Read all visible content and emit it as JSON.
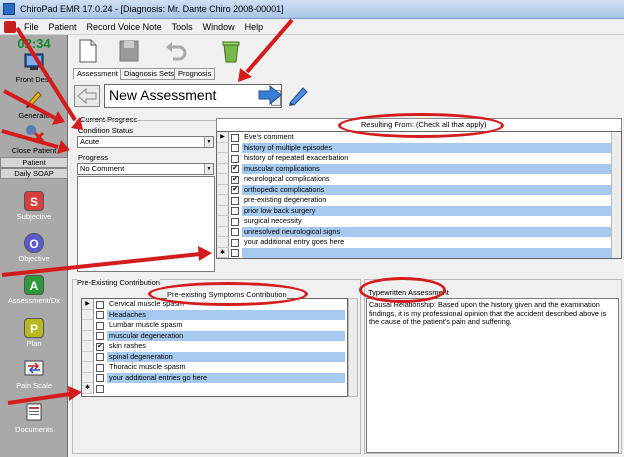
{
  "window": {
    "title": "ChiroPad EMR  17.0.24 - [Diagnosis: Mr. Dante Chiro 2008-00001]"
  },
  "menu": [
    "File",
    "Patient",
    "Record Voice Note",
    "Tools",
    "Window",
    "Help"
  ],
  "sidebar": {
    "clock": "02:34",
    "items": {
      "front_desk": "Front Desk",
      "generate": "Generate",
      "close_patient": "Close Patient",
      "patient": "Patient",
      "daily_soap": "Daily SOAP",
      "subjective": "Subjective",
      "objective": "Objective",
      "assessment": "Assessment/Dx",
      "plan": "Plan",
      "pain_scale": "Pain Scale",
      "documents": "Documents"
    },
    "letters": {
      "s": "S",
      "o": "O",
      "a": "A",
      "p": "P"
    }
  },
  "tabs": [
    "Assessment",
    "Diagnosis Sets",
    "Prognosis"
  ],
  "assessment_select": "New Assessment",
  "current_progress": {
    "group_label": "Current Progress",
    "condition_label": "Condition Status",
    "condition_value": "Acute",
    "progress_label": "Progress",
    "progress_value": "No Comment"
  },
  "resulting_from": {
    "header": "Resulting From:  (Check all that apply)",
    "rows": [
      {
        "text": "Eve's comment",
        "checked": false,
        "hl": false,
        "current": true
      },
      {
        "text": "history of multiple episodes",
        "checked": false,
        "hl": true
      },
      {
        "text": "history of repeated exacerbation",
        "checked": false,
        "hl": false
      },
      {
        "text": "muscular complications",
        "checked": true,
        "hl": true
      },
      {
        "text": "neurological complications",
        "checked": true,
        "hl": false
      },
      {
        "text": "orthopedic complications",
        "checked": true,
        "hl": true
      },
      {
        "text": "pre-existing degeneration",
        "checked": false,
        "hl": false
      },
      {
        "text": "prior low back surgery",
        "checked": false,
        "hl": true
      },
      {
        "text": "surgical necessity",
        "checked": false,
        "hl": false
      },
      {
        "text": "unresolved neurological signs",
        "checked": false,
        "hl": true
      },
      {
        "text": "your additional entry goes here",
        "checked": false,
        "hl": false
      },
      {
        "text": "",
        "checked": false,
        "hl": true,
        "new": true
      }
    ]
  },
  "pre_existing": {
    "group_label": "Pre-Existing Contribution",
    "header": "Pre-existing Symptoms Contribution",
    "rows": [
      {
        "text": "Cervical muscle spasm",
        "checked": false,
        "hl": false,
        "current": true
      },
      {
        "text": "Headaches",
        "checked": false,
        "hl": true
      },
      {
        "text": "Lumbar muscle spasm",
        "checked": false,
        "hl": false
      },
      {
        "text": "muscular degeneration",
        "checked": false,
        "hl": true
      },
      {
        "text": "skin rashes",
        "checked": true,
        "hl": false
      },
      {
        "text": "spinal degeneration",
        "checked": false,
        "hl": true
      },
      {
        "text": "Thoracic muscle spasm",
        "checked": false,
        "hl": false
      },
      {
        "text": "your additional entries go here",
        "checked": false,
        "hl": true
      },
      {
        "text": "",
        "checked": false,
        "hl": false,
        "new": true
      }
    ]
  },
  "typewritten": {
    "header": "Typewritten Assessment",
    "text": "Causal Relationship:  Based upon the history given and the examination findings, it is my professional opinion that the accident described above is the cause of the patient's pain and suffering."
  },
  "glyphs": {
    "current_row": "▶",
    "new_row": "✱",
    "check": "✔",
    "dropdown": "▼"
  },
  "colors": {
    "highlight": "#a6c9ef",
    "annotation_red": "#d41c1c",
    "clock_green": "#0a8a2a"
  }
}
